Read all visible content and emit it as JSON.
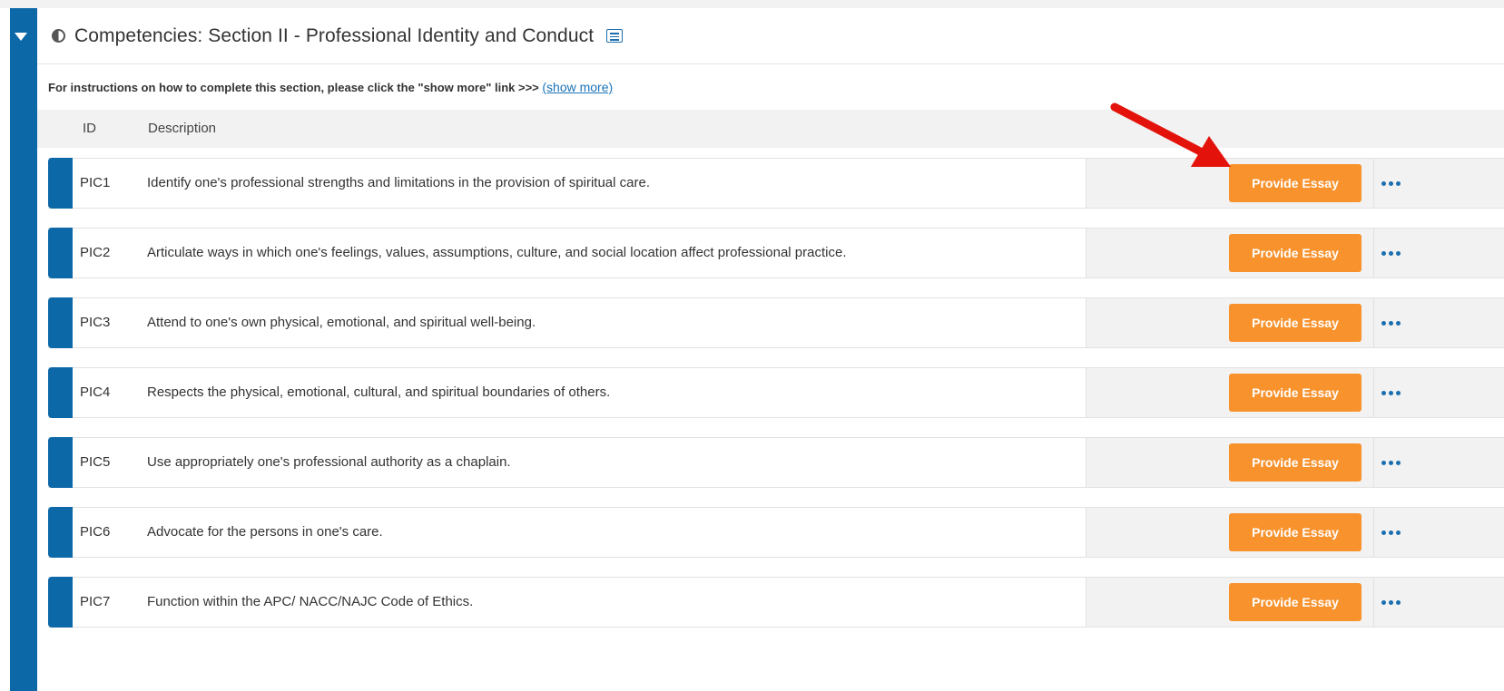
{
  "section": {
    "title": "Competencies: Section II - Professional Identity and Conduct",
    "instructions_text": "For instructions on how to complete this section, please click the \"show more\" link >>> ",
    "show_more_label": "(show more)"
  },
  "table": {
    "columns": {
      "id": "ID",
      "description": "Description"
    },
    "button_label": "Provide Essay",
    "rows": [
      {
        "id": "PIC1",
        "description": "Identify one's professional strengths and limitations in the provision of spiritual care."
      },
      {
        "id": "PIC2",
        "description": "Articulate ways in which one's feelings, values, assumptions, culture, and social location affect professional practice."
      },
      {
        "id": "PIC3",
        "description": "Attend to one's own physical, emotional, and spiritual well-being."
      },
      {
        "id": "PIC4",
        "description": "Respects the physical, emotional, cultural, and spiritual boundaries of others."
      },
      {
        "id": "PIC5",
        "description": "Use appropriately one's professional authority as a chaplain."
      },
      {
        "id": "PIC6",
        "description": "Advocate for the persons in one's care."
      },
      {
        "id": "PIC7",
        "description": "Function within the APC/ NACC/NAJC Code of Ethics."
      }
    ]
  },
  "icons": {
    "collapse": "caret-down-icon",
    "section": "half-circle-icon",
    "list": "list-icon",
    "more": "ellipsis-icon",
    "annotation": "red-arrow-icon"
  },
  "colors": {
    "primary_blue": "#0d68a8",
    "button_orange": "#f7922d",
    "annotation_red": "#e3120b"
  }
}
